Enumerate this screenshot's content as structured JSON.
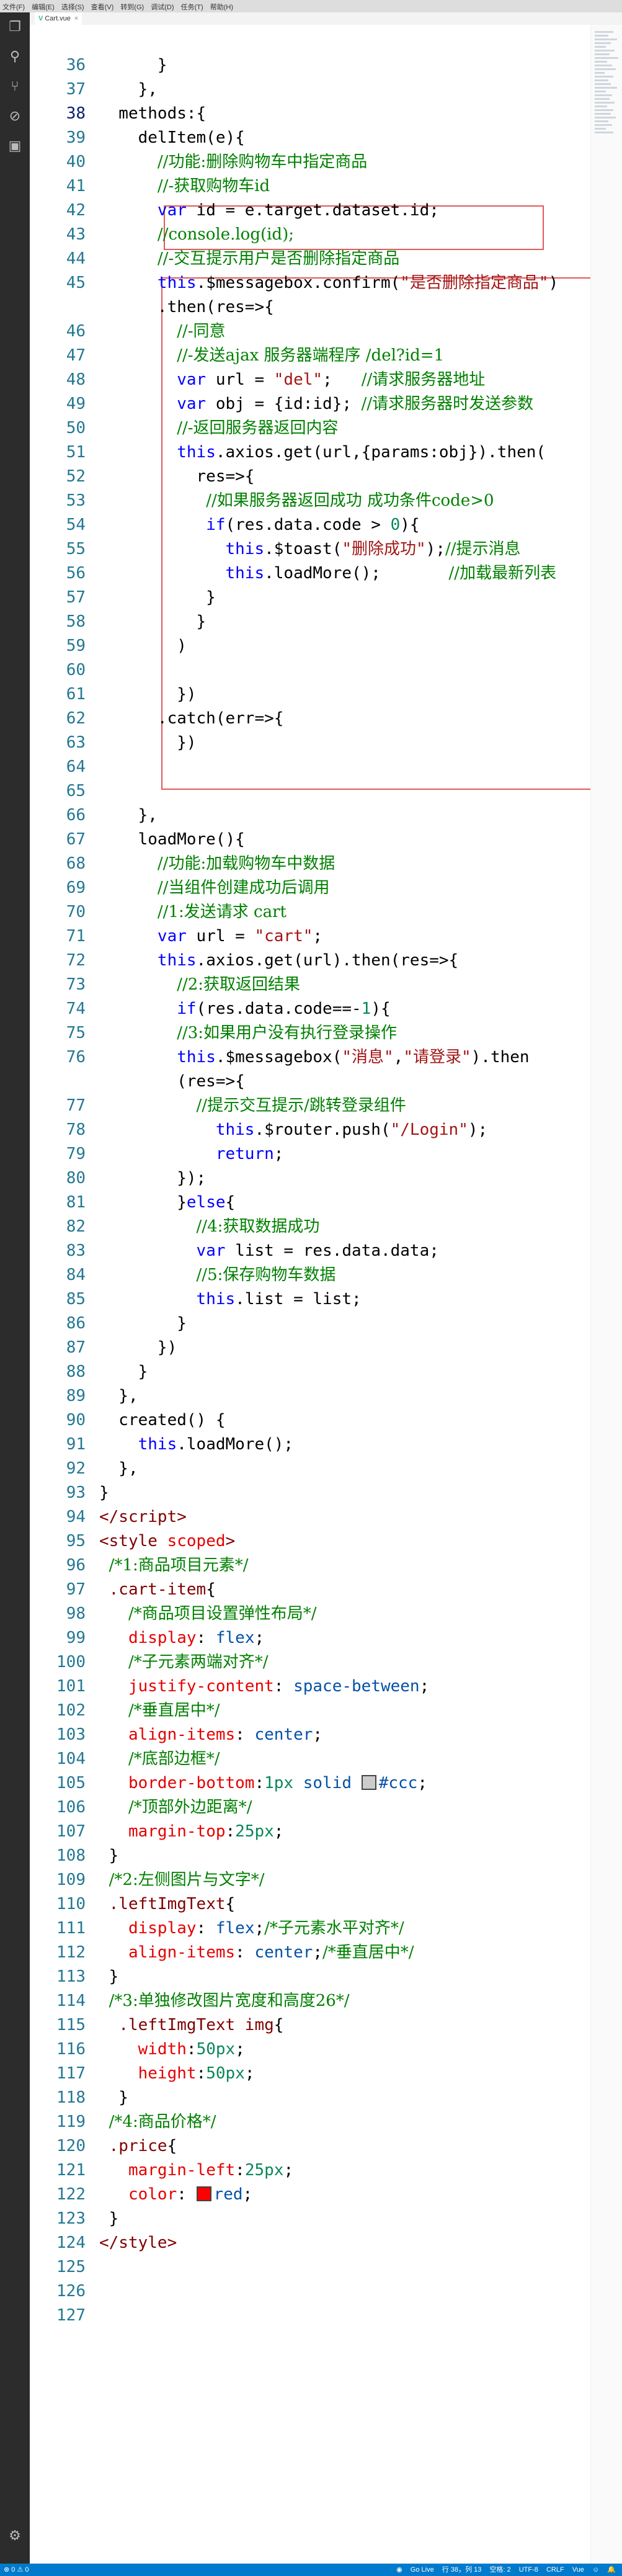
{
  "menu": [
    "文件(F)",
    "编辑(E)",
    "选择(S)",
    "查看(V)",
    "转到(G)",
    "调试(D)",
    "任务(T)",
    "帮助(H)"
  ],
  "tab": {
    "icon": "V",
    "label": "Cart.vue"
  },
  "status": {
    "errors": "0",
    "warnings": "0",
    "golive": "Go Live",
    "position": "行 38，列 13",
    "spaces": "空格: 2",
    "encoding": "UTF-8",
    "eol": "CRLF",
    "language": "Vue"
  },
  "icons": {
    "explorer": "files-icon",
    "search": "search-icon",
    "scm": "source-control-icon",
    "debug": "debug-icon",
    "extensions": "extensions-icon",
    "settings": "gear-icon"
  }
}
